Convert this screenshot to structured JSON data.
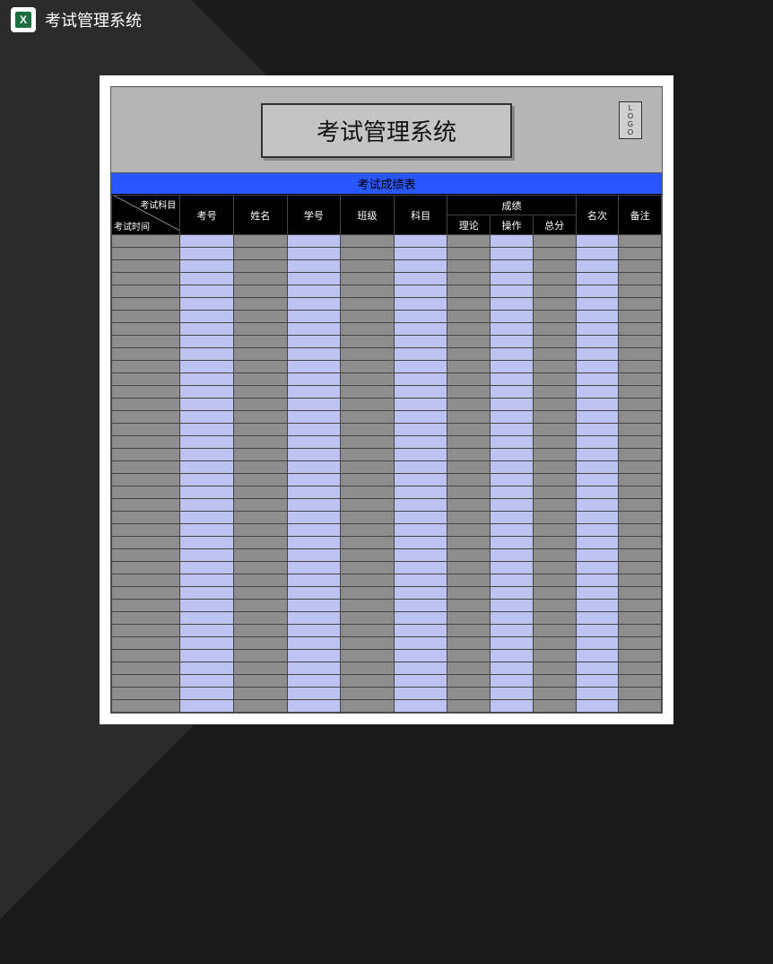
{
  "topbar": {
    "title": "考试管理系统",
    "icon_letter": "X"
  },
  "sheet": {
    "title": "考试管理系统",
    "logo": [
      "L",
      "O",
      "G",
      "O"
    ],
    "subtitle": "考试成绩表",
    "headers": {
      "diagonal_top": "考试科目",
      "diagonal_bottom": "考试时间",
      "exam_number": "考号",
      "name": "姓名",
      "student_id": "学号",
      "class": "班级",
      "subject": "科目",
      "score_group": "成绩",
      "score_theory": "理论",
      "score_practice": "操作",
      "score_total": "总分",
      "rank": "名次",
      "remark": "备注"
    },
    "row_count": 38,
    "column_pattern": [
      "grey",
      "lav",
      "grey",
      "lav",
      "grey",
      "lav",
      "grey",
      "lav",
      "grey",
      "lav",
      "grey"
    ],
    "colors": {
      "grey": "#8d8d8d",
      "lavender": "#bdc3f2",
      "header_black": "#000000",
      "subtitle_blue": "#2a56ff",
      "page_bg": "#1a1a1a",
      "panel_bg": "#b5b5b5"
    }
  }
}
